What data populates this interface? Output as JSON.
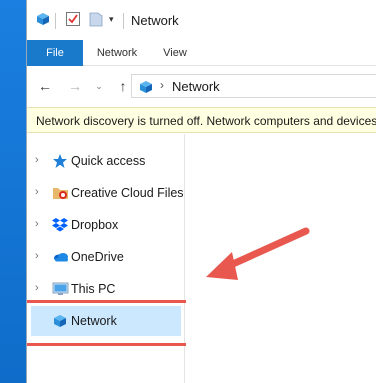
{
  "window": {
    "title": "Network"
  },
  "quick_access_toolbar": {
    "icons": [
      "network-icon",
      "properties-check-icon",
      "new-folder-icon",
      "customize-dropdown-icon"
    ],
    "dropdown_glyph": "▾"
  },
  "ribbon": {
    "tabs": [
      {
        "label": "File",
        "active": true
      },
      {
        "label": "Network",
        "active": false
      },
      {
        "label": "View",
        "active": false
      }
    ]
  },
  "navigation": {
    "back_glyph": "←",
    "forward_glyph": "→",
    "recent_glyph": "⌄",
    "up_glyph": "↑",
    "address": {
      "chevron": "›",
      "location": "Network"
    }
  },
  "info_bar": {
    "message": "Network discovery is turned off. Network computers and devices are not visible."
  },
  "nav_pane": {
    "chevron_glyph": "›",
    "items": [
      {
        "label": "Quick access",
        "icon": "star-icon"
      },
      {
        "label": "Creative Cloud Files",
        "icon": "creative-cloud-folder-icon"
      },
      {
        "label": "Dropbox",
        "icon": "dropbox-icon"
      },
      {
        "label": "OneDrive",
        "icon": "onedrive-cloud-icon"
      },
      {
        "label": "This PC",
        "icon": "computer-icon"
      },
      {
        "label": "Network",
        "icon": "network-icon",
        "selected": true
      }
    ]
  },
  "colors": {
    "accent": "#1979ca",
    "selection": "#cce8ff",
    "info_bar_bg": "#ffffe1",
    "annotation": "#e8584f",
    "desktop": "#1577d6"
  }
}
